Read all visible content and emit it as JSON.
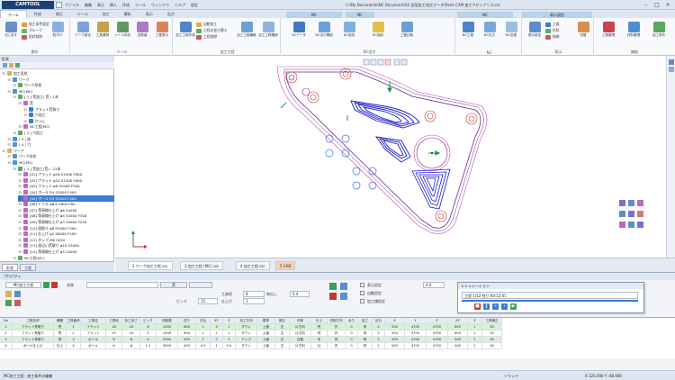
{
  "app": {
    "logo": "CAMTOOL",
    "title": "C:\\My Documents\\NC Document\\02 金型加工\\加工データ\\Parts CAM 加工アセンブリ 2.csc"
  },
  "menu": [
    "ファイル",
    "編集",
    "表示",
    "挿入",
    "作成",
    "ツール",
    "ウィンドウ",
    "ヘルプ",
    "設定"
  ],
  "ribbon_tabs": [
    "ホーム",
    "作成",
    "修正",
    "ツール",
    "加工",
    "解析",
    "表示",
    "出力"
  ],
  "context_tabs": [
    "NC",
    "NC",
    "NC",
    "表示設定"
  ],
  "ribbon_groups": [
    {
      "label": "操作",
      "buttons": [
        "元に戻す",
        "貼付け"
      ],
      "small": [
        "加工条件設定",
        "グループ",
        "形状削除"
      ]
    },
    {
      "label": "ツール",
      "buttons": [
        "ワーク設定",
        "工具選択",
        "ツール作成",
        "全数値",
        "工程表示"
      ]
    },
    {
      "label": "加工工程",
      "buttons": [
        "加工工程作成",
        "加工工程編集",
        "加工工程確認"
      ],
      "small": [
        "自動加工",
        "工程の並び替え",
        "工程削除"
      ]
    },
    {
      "label": "NC出力",
      "buttons": [
        "NCデータ",
        "NC出力確認",
        "NC追加",
        "NC保存",
        "工程比較"
      ]
    },
    {
      "label": "NC",
      "buttons": [
        "NC工程",
        "NC出力",
        "NC変更"
      ]
    },
    {
      "label": "表示",
      "buttons": [
        "表示設定",
        "切替"
      ],
      "small": [
        "工具",
        "形状",
        "軌跡"
      ]
    },
    {
      "label": "機能",
      "buttons": [
        "工具管理",
        "材料管理",
        "加工条件"
      ]
    }
  ],
  "tree": {
    "header": "形状",
    "items": [
      {
        "text": "加工形状",
        "level": 0
      },
      {
        "text": "ワーク",
        "level": 1
      },
      {
        "text": "ワーク形状",
        "level": 2
      },
      {
        "text": "MC(MC)",
        "level": 1
      },
      {
        "text": "[ 1 ] 荒加工( 荒 ) 1本",
        "level": 2
      },
      {
        "text": "荒",
        "level": 3
      },
      {
        "text": "フラット荒取り",
        "level": 4
      },
      {
        "text": "穴加工",
        "level": 4
      },
      {
        "text": "穴 (1)",
        "level": 4
      },
      {
        "text": "NC工程(MC)",
        "level": 3
      },
      {
        "text": "[ 2 ] 穴加工",
        "level": 2
      },
      {
        "text": "( 3 ) 面",
        "level": 1
      },
      {
        "text": "( 4 ) 穴",
        "level": 1
      },
      {
        "text": "ワーク",
        "level": 0
      },
      {
        "text": "ワーク形状",
        "level": 1
      },
      {
        "text": "MC(MC)",
        "level": 1
      },
      {
        "text": "[ 1 ] 荒加工(荒) : 12本",
        "level": 2
      },
      {
        "text": "[01] フラット φ16 S1000 F800",
        "level": 3
      },
      {
        "text": "[02] フラット φ10 S1500 F600",
        "level": 3
      },
      {
        "text": "[03] フラット φ8 S2000 F500",
        "level": 3
      },
      {
        "text": "[04] ボール R4 S3000 F400",
        "level": 3
      },
      {
        "text": "[05] ボール R3 S3500 F400",
        "level": 3
      },
      {
        "text": "[06] ドリル φ6.8 S800 F80",
        "level": 3
      },
      {
        "text": "[07] 等高線仕上げ φ6 S4000",
        "level": 3
      },
      {
        "text": "[08] 等高線仕上げ φ4 S4500 F300",
        "level": 3
      },
      {
        "text": "[09] 等高線仕上げ φ3 S5000 F250",
        "level": 3
      },
      {
        "text": "[10] 面取り φ6 S3000 F300",
        "level": 3
      },
      {
        "text": "[11] 仕上げ φ2 S6000 F200",
        "level": 3
      },
      {
        "text": "[12] タップ M8 S200",
        "level": 3
      },
      {
        "text": "[13] 面沿い荒取り φ10 S2000",
        "level": 3
      },
      {
        "text": "[14] 等高線仕上げ φ5 S4000",
        "level": 3
      },
      {
        "text": "NC工程(MC)",
        "level": 2
      }
    ],
    "highlight": 21,
    "bottom_tabs": [
      "形状",
      "工程"
    ]
  },
  "doc_tabs": [
    "2 ワーク加工工程.csc",
    "3 加工工程 (MC).csc",
    "4 加工工程.csc",
    "5 CAD"
  ],
  "panel": {
    "title": "プロパティ",
    "process_label": "MC加工工程",
    "name_label": "名称",
    "name_value": "荒",
    "fields": [
      {
        "label": "工具径",
        "value": "8"
      },
      {
        "label": "突出し",
        "value": "0.4"
      },
      {
        "label": "ピッチ",
        "value": "15"
      },
      {
        "label": "仕上げ",
        "value": "1"
      }
    ],
    "checks": [
      "表示設定",
      "自動設定",
      "加工順設定"
    ],
    "z_value": "4.0"
  },
  "dialog": {
    "title": "シミュレーション",
    "info": "工程 1/12  残り 00:12:45",
    "buttons": [
      "停止",
      "一時",
      "早送",
      "次",
      "再生"
    ]
  },
  "grid": {
    "headers": [
      "No",
      "工程名称",
      "種類",
      "工具番号",
      "工具名",
      "工具径",
      "加工深さ",
      "ピッチ",
      "回転数",
      "送り",
      "切込",
      "XY",
      "Z",
      "加工方向",
      "基準",
      "補正",
      "切削",
      "仕上",
      "切削方向",
      "余り",
      "加工",
      "区分",
      "X",
      "Y",
      "Z",
      "XY",
      "Z",
      "工具補正"
    ],
    "rows": [
      [
        "1",
        "フラット荒取り",
        "荒",
        "1",
        "フラット",
        "16",
        "-10",
        "8",
        "1000",
        "800",
        "1",
        "3",
        "1",
        "ダウン",
        "上面",
        "左",
        "片方向",
        "荒",
        "外",
        "0",
        "有",
        "2",
        "500",
        "4700",
        "4700",
        "800",
        "1",
        "30"
      ],
      [
        "2",
        "フラット荒取り",
        "荒",
        "2",
        "フラット",
        "10",
        "-10",
        "5",
        "1500",
        "600",
        "1",
        "2",
        "1",
        "ダウン",
        "上面",
        "左",
        "片方向",
        "荒",
        "外",
        "0",
        "有",
        "2",
        "500",
        "4700",
        "4700",
        "600",
        "1",
        "30"
      ],
      [
        "3",
        "フラット荒取り",
        "荒",
        "3",
        "ボール",
        "8",
        "-8",
        "4",
        "2000",
        "500",
        "1",
        "2",
        "1",
        "アップ",
        "上面",
        "左",
        "往復",
        "中",
        "内",
        "0",
        "有",
        "2",
        "500",
        "4700",
        "4700",
        "500",
        "1",
        "30"
      ],
      [
        "4",
        "ボール仕上げ",
        "仕上",
        "4",
        "ボール",
        "6",
        "-6",
        "1.2",
        "3000",
        "400",
        "0.5",
        "1",
        "0.5",
        "ダウン",
        "上面",
        "左",
        "片方向",
        "仕",
        "内",
        "0",
        "有",
        "2",
        "500",
        "4700",
        "4700",
        "400",
        "1",
        "30"
      ]
    ]
  },
  "status": {
    "left": "MC加工工程・加工条件の編集",
    "right": "ソリッド",
    "coords": "X 125.000 Y -48.000"
  },
  "colors": {
    "accent": "#3a7bd5",
    "part_outline": "#7a1f8c",
    "toolpath": "#1b1bd0",
    "holes": "#3c6fe0",
    "green_row": "#d8f0d4"
  }
}
